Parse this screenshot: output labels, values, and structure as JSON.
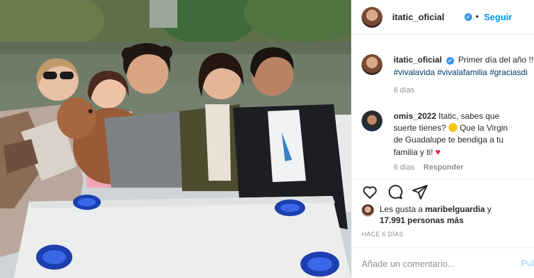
{
  "photo": {
    "alt": ""
  },
  "header": {
    "username": "itatic_oficial",
    "separator": "•",
    "follow_label": "Seguir"
  },
  "caption": {
    "username": "itatic_oficial",
    "text": "Primer día del año !!!",
    "hashtags": "#vivalavida #vivalafamilia #graciasdi",
    "time": "6 días"
  },
  "comment": {
    "username": "omis_2022",
    "text_1": "Itatic, sabes que",
    "text_2": "suerte tienes?",
    "text_3": "Que la Virgin",
    "text_4": "de Guadalupe te bendiga a tu",
    "text_5": "familia y ti!",
    "time": "6 días",
    "reply_label": "Responder"
  },
  "likes": {
    "prefix": "Les gusta a",
    "user": "maribelguardia",
    "connector": "y",
    "count": "17.991 personas más"
  },
  "post_time": "HACE 6 DÍAS",
  "add_comment": {
    "placeholder": "Añade un comentario...",
    "post_label": "Pub"
  },
  "colors": {
    "link": "#0095f6",
    "hashtag": "#00376b",
    "verified": "#3897f0",
    "muted": "#8e8e8e"
  }
}
